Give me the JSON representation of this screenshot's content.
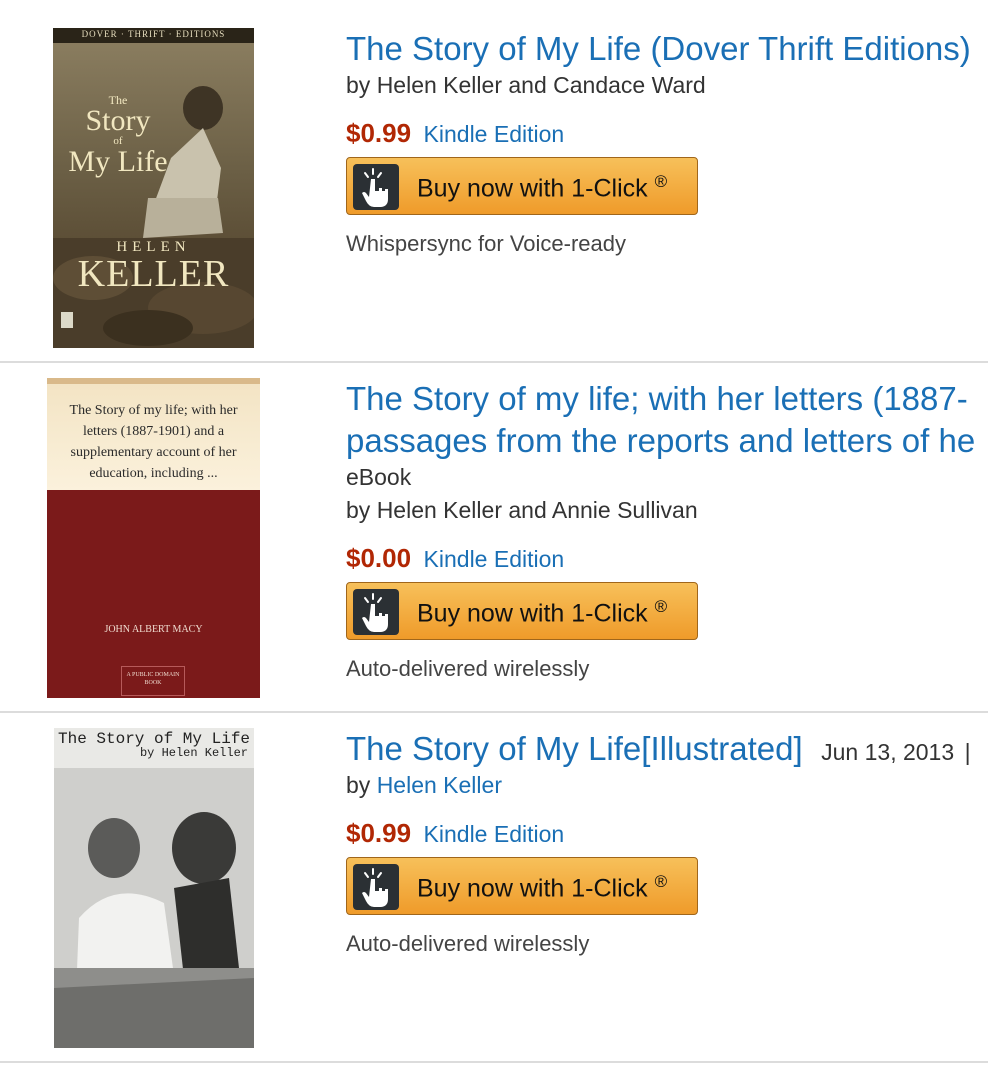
{
  "results": [
    {
      "cover": {
        "series_banner": "DOVER · THRIFT · EDITIONS",
        "title_small": "The",
        "title_line1": "Story",
        "title_of": "of",
        "title_line2": "My Life",
        "author_first": "HELEN",
        "author_last": "KELLER"
      },
      "title": "The Story of My Life (Dover Thrift Editions)",
      "by_prefix": "by",
      "authors": "Helen Keller and Candace Ward",
      "price": "$0.99",
      "format": "Kindle Edition",
      "buy_label": "Buy now with 1-Click",
      "buy_mark": "®",
      "note": "Whispersync for Voice-ready"
    },
    {
      "cover": {
        "text": "The Story of my life; with her letters (1887-1901) and a supplementary account of her education, including ...",
        "author": "JOHN ALBERT MACY",
        "badge": "A PUBLIC DOMAIN BOOK"
      },
      "title_line1": "The Story of my life; with her letters (1887-",
      "title_line2": "passages from the reports and letters of he",
      "media": "eBook",
      "by_prefix": "by",
      "authors": "Helen Keller and Annie Sullivan",
      "price": "$0.00",
      "format": "Kindle Edition",
      "buy_label": "Buy now with 1-Click",
      "buy_mark": "®",
      "note": "Auto-delivered wirelessly"
    },
    {
      "cover": {
        "title": "The Story of My Life",
        "byline": "by Helen Keller"
      },
      "title": "The Story of My Life[Illustrated]",
      "date": "Jun 13, 2013",
      "date_sep": "|",
      "by_prefix": "by",
      "authors": "Helen Keller",
      "price": "$0.99",
      "format": "Kindle Edition",
      "buy_label": "Buy now with 1-Click",
      "buy_mark": "®",
      "note": "Auto-delivered wirelessly"
    }
  ],
  "icons": {
    "buy": "pointing-hand-icon"
  },
  "colors": {
    "link": "#1a6fb5",
    "price": "#b12704",
    "button": "#f0a634"
  }
}
